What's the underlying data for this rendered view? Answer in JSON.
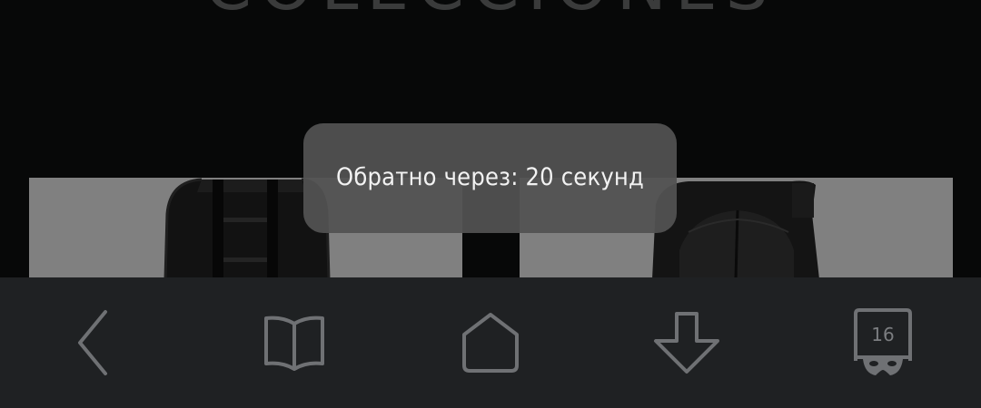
{
  "page": {
    "heading": "COLECCIONES"
  },
  "products": [
    {
      "image": "black-backpack-front"
    },
    {
      "image": "black-backpack-back"
    }
  ],
  "toast": {
    "message": "Обратно через: 20 секунд"
  },
  "bottom_bar": {
    "items": [
      {
        "icon": "back-arrow-icon"
      },
      {
        "icon": "book-icon"
      },
      {
        "icon": "home-icon"
      },
      {
        "icon": "download-icon"
      },
      {
        "icon": "tabs-incognito-icon",
        "count": "16"
      }
    ],
    "icon_color": "#6f7174",
    "background": "#1f2123"
  },
  "colors": {
    "page_background": "#070808",
    "toast_background": "#525252",
    "card_background": "#808080"
  }
}
